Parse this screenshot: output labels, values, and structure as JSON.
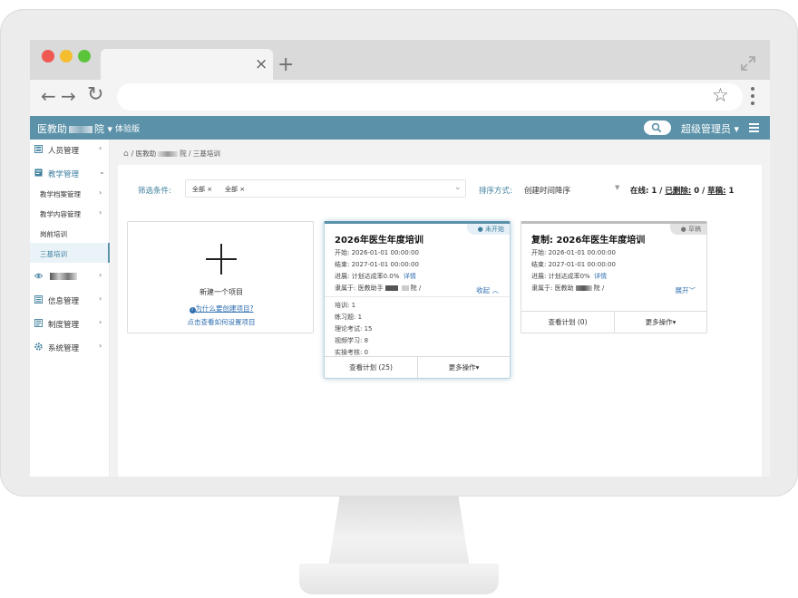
{
  "browser": {
    "tab_close": "×",
    "tab_new": "+"
  },
  "header": {
    "title_prefix": "医教助",
    "title_suffix": "院",
    "edition": "体验版",
    "user": "超级管理员",
    "accent": "#5b92a9"
  },
  "sidebar": {
    "items": [
      {
        "label": "人员管理",
        "icon": "users-icon"
      },
      {
        "label": "教学管理",
        "icon": "teaching-icon"
      },
      {
        "label": "信息管理",
        "icon": "info-icon"
      },
      {
        "label": "制度管理",
        "icon": "rules-icon"
      },
      {
        "label": "系统管理",
        "icon": "gear-icon"
      }
    ],
    "sub_items": [
      {
        "label": "教学档案管理"
      },
      {
        "label": "教学内容管理"
      },
      {
        "label": "岗前培训"
      },
      {
        "label": "三基培训"
      }
    ]
  },
  "breadcrumb": {
    "root": "医教助",
    "root_suffix": "院",
    "current": "三基培训"
  },
  "filters": {
    "label": "筛选条件:",
    "chips": [
      "全部",
      "全部"
    ],
    "sort_label": "排序方式:",
    "sort_value": "创建时间降序",
    "online_label": "在线:",
    "online_value": "1",
    "deleted_label": "已删除:",
    "deleted_value": "0",
    "draft_label": "草稿:",
    "draft_value": "1"
  },
  "new_card": {
    "title": "新建一个项目",
    "why_link": "为什么要创建项目?",
    "how_link": "点击查看如何设置项目"
  },
  "plan_card": {
    "badge": "● 未开始",
    "title": "2026年医生年度培训",
    "start": "开始: 2026-01-01 00:00:00",
    "end": "结束: 2027-01-01 00:00:00",
    "progress": "进展: 计划达成率0.0%",
    "detail": "详情",
    "belongs": "隶属于: 医教助手",
    "belongs_suffix": "院 /",
    "collapse": "收起",
    "stats": [
      "培训: 1",
      "练习题: 1",
      "理论考试: 15",
      "视频学习: 8",
      "实操考核: 0"
    ],
    "view_plan": "查看计划 (25)",
    "more_ops": "更多操作"
  },
  "draft_card": {
    "badge": "● 草稿",
    "title": "复制: 2026年医生年度培训",
    "start": "开始: 2026-01-01 00:00:00",
    "end": "结束: 2027-01-01 00:00:00",
    "progress": "进展: 计划达成率0%",
    "detail": "详情",
    "belongs": "隶属于: 医教助",
    "belongs_suffix": "院 /",
    "expand": "展开",
    "view_plan": "查看计划 (0)",
    "more_ops": "更多操作"
  }
}
